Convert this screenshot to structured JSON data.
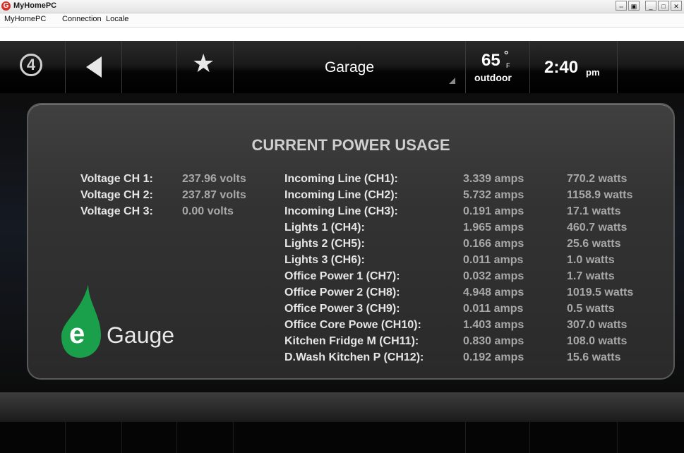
{
  "window": {
    "title": "MyHomePC",
    "app_icon": "app-logo-icon",
    "buttons": [
      "⇔",
      "▣",
      "_",
      "□",
      "✕"
    ]
  },
  "menubar": [
    "MyHomePC",
    "Connection",
    "Locale"
  ],
  "nav": {
    "room": "Garage",
    "temperature": "65",
    "temperature_degree": "°",
    "temperature_unit": "F",
    "temperature_label": "outdoor",
    "time": "2:40",
    "ampm": "pm",
    "icons": [
      "home-logo-icon",
      "back-arrow-icon",
      "favorites-star-icon"
    ]
  },
  "panel": {
    "title": "CURRENT POWER USAGE",
    "voltages": [
      {
        "label": "Voltage CH 1:",
        "value": "237.96 volts"
      },
      {
        "label": "Voltage CH 2:",
        "value": "237.87 volts"
      },
      {
        "label": "Voltage CH 3:",
        "value": "0.00 volts"
      }
    ],
    "channels": [
      {
        "name": "Incoming Line  (CH1):",
        "amps": "3.339 amps",
        "watts": "770.2 watts"
      },
      {
        "name": "Incoming Line  (CH2):",
        "amps": "5.732 amps",
        "watts": "1158.9 watts"
      },
      {
        "name": "Incoming Line  (CH3):",
        "amps": "0.191 amps",
        "watts": "17.1 watts"
      },
      {
        "name": "Lights 1 (CH4):",
        "amps": "1.965 amps",
        "watts": "460.7 watts"
      },
      {
        "name": "Lights 2 (CH5):",
        "amps": "0.166 amps",
        "watts": "25.6 watts"
      },
      {
        "name": "Lights 3 (CH6):",
        "amps": "0.011 amps",
        "watts": "1.0 watts"
      },
      {
        "name": "Office Power 1 (CH7):",
        "amps": "0.032 amps",
        "watts": "1.7 watts"
      },
      {
        "name": "Office Power 2 (CH8):",
        "amps": "4.948 amps",
        "watts": "1019.5 watts"
      },
      {
        "name": "Office Power 3 (CH9):",
        "amps": "0.011 amps",
        "watts": "0.5 watts"
      },
      {
        "name": "Office Core Powe (CH10):",
        "amps": "1.403 amps",
        "watts": "307.0 watts"
      },
      {
        "name": "Kitchen Fridge M (CH11):",
        "amps": "0.830 amps",
        "watts": "108.0 watts"
      },
      {
        "name": "D.Wash Kitchen P (CH12):",
        "amps": "0.192 amps",
        "watts": "15.6 watts"
      }
    ],
    "logo": {
      "letter": "e",
      "text": "Gauge",
      "color": "#1aa04a"
    }
  }
}
